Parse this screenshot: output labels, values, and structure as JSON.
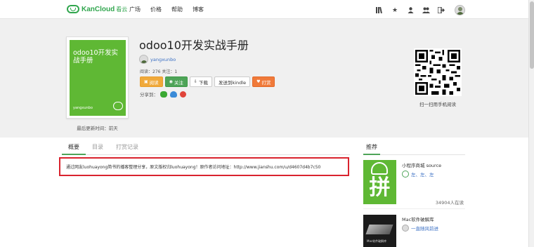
{
  "header": {
    "logo_text": "KanCloud",
    "logo_cn": "看云",
    "nav": [
      "广场",
      "价格",
      "帮助",
      "博客"
    ],
    "icons": [
      "bookshelf-icon",
      "star-icon",
      "user-icon",
      "users-icon",
      "logout-icon"
    ]
  },
  "book": {
    "cover_title": "odoo10开发实战手册",
    "cover_author": "yangxunbo",
    "updated": "最后更新时间：前天",
    "title": "odoo10开发实战手册",
    "author": "yangxunbo",
    "stats": "阅读：276 关注：1",
    "buttons": {
      "read": "阅读",
      "follow": "关注",
      "download": "下载",
      "kindle": "发送到kindle",
      "tip": "打赏"
    },
    "share_label": "分享到：",
    "qr_caption": "扫一扫用手机阅读"
  },
  "tabs": [
    "概要",
    "目录",
    "打赏记录"
  ],
  "description": "通过网友luohuayong简书的播客整理分享，原文版权归luohuayong！原作者访问地址：http://www.jianshu.com/u/d4607d4b7c50",
  "recommend": {
    "title": "推荐",
    "items": [
      {
        "name": "小程序商城 source",
        "author": "左、左、左",
        "reads": "34904人在读",
        "cover_char": "拼"
      },
      {
        "name": "Mac软件破解库",
        "author": "一直随风前进",
        "cover_label": "Mac软件破解库"
      }
    ]
  },
  "colors": {
    "brand_green": "#31a64e",
    "highlight_red": "#d9232e",
    "cover_green": "#5fb834"
  }
}
